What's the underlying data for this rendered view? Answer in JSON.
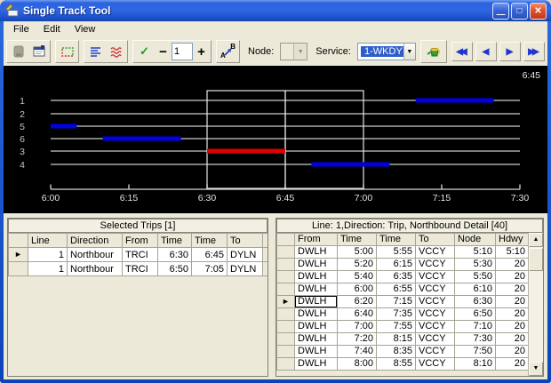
{
  "window": {
    "title": "Single Track Tool",
    "controls": [
      {
        "name": "minimize",
        "glyph": "—"
      },
      {
        "name": "maximize",
        "glyph": "□"
      },
      {
        "name": "close",
        "glyph": "✕"
      }
    ]
  },
  "menu": {
    "items": [
      "File",
      "Edit",
      "View"
    ]
  },
  "toolbar": {
    "check_glyph": "✓",
    "minus_label": "−",
    "plus_label": "+",
    "zoom_value": "1",
    "ab_a": "A",
    "ab_b": "B",
    "node_label": "Node:",
    "node_value": "",
    "service_label": "Service:",
    "service_value": "1-WKDY",
    "combo_arrow": "▼",
    "nav": [
      {
        "name": "first",
        "glyph": "◀◀"
      },
      {
        "name": "previous",
        "glyph": "◀"
      },
      {
        "name": "next",
        "glyph": "▶"
      },
      {
        "name": "last",
        "glyph": "▶▶"
      }
    ]
  },
  "chart": {
    "corner_label": "6:45",
    "time_start": "6:00",
    "time_end": "7:30",
    "x_ticks": [
      "6:00",
      "6:15",
      "6:30",
      "6:45",
      "7:00",
      "7:15",
      "7:30"
    ],
    "track_labels": [
      "1",
      "2",
      "5",
      "6",
      "3",
      "4"
    ],
    "segments": [
      {
        "track": "5",
        "start": "6:00",
        "end": "6:05",
        "color": "#0000e0"
      },
      {
        "track": "6",
        "start": "6:10",
        "end": "6:25",
        "color": "#0000e0"
      },
      {
        "track": "3",
        "start": "6:30",
        "end": "6:45",
        "color": "#e00000"
      },
      {
        "track": "4",
        "start": "6:50",
        "end": "7:05",
        "color": "#0000e0"
      },
      {
        "track": "1",
        "start": "7:10",
        "end": "7:25",
        "color": "#0000e0"
      }
    ],
    "selection_boxes": [
      {
        "start": "6:30",
        "end": "6:45"
      },
      {
        "start": "6:45",
        "end": "7:00"
      }
    ]
  },
  "tables": {
    "marker_glyph": "►"
  },
  "left_table": {
    "title": "Selected Trips [1]",
    "columns": [
      "Line",
      "Direction",
      "From",
      "Time",
      "Time",
      "To"
    ],
    "col_align": [
      "right",
      "left",
      "left",
      "right",
      "right",
      "left"
    ],
    "rows": [
      [
        "1",
        "Northbour",
        "TRCI",
        "6:30",
        "6:45",
        "DYLN"
      ],
      [
        "1",
        "Northbour",
        "TRCI",
        "6:50",
        "7:05",
        "DYLN"
      ]
    ],
    "selected_row": 0
  },
  "right_table": {
    "title": "Line: 1,Direction: Trip, Northbound Detail [40]",
    "columns": [
      "From",
      "Time",
      "Time",
      "To",
      "Node",
      "Hdwy"
    ],
    "col_align": [
      "left",
      "right",
      "right",
      "left",
      "right",
      "right"
    ],
    "rows": [
      [
        "DWLH",
        "5:00",
        "5:55",
        "VCCY",
        "5:10",
        "5:10"
      ],
      [
        "DWLH",
        "5:20",
        "6:15",
        "VCCY",
        "5:30",
        "20"
      ],
      [
        "DWLH",
        "5:40",
        "6:35",
        "VCCY",
        "5:50",
        "20"
      ],
      [
        "DWLH",
        "6:00",
        "6:55",
        "VCCY",
        "6:10",
        "20"
      ],
      [
        "DWLH",
        "6:20",
        "7:15",
        "VCCY",
        "6:30",
        "20"
      ],
      [
        "DWLH",
        "6:40",
        "7:35",
        "VCCY",
        "6:50",
        "20"
      ],
      [
        "DWLH",
        "7:00",
        "7:55",
        "VCCY",
        "7:10",
        "20"
      ],
      [
        "DWLH",
        "7:20",
        "8:15",
        "VCCY",
        "7:30",
        "20"
      ],
      [
        "DWLH",
        "7:40",
        "8:35",
        "VCCY",
        "7:50",
        "20"
      ],
      [
        "DWLH",
        "8:00",
        "8:55",
        "VCCY",
        "8:10",
        "20"
      ]
    ],
    "selected_row": 4,
    "focused_cell": {
      "row": 4,
      "col": 0
    }
  },
  "scrollbar": {
    "up": "▲",
    "down": "▼"
  },
  "colors": {
    "trip_blue": "#0000e0",
    "trip_selected_red": "#e00000",
    "selection_highlight": "#2f5ec8",
    "chart_background": "#000000",
    "ui_background": "#ece9d8"
  }
}
